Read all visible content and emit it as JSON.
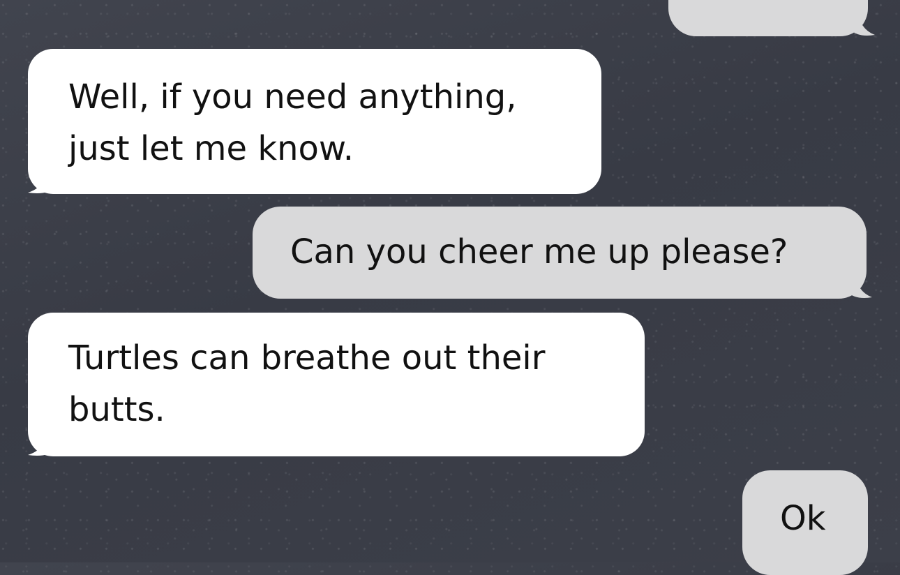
{
  "conversation": {
    "messages": [
      {
        "sender": "other",
        "text": ""
      },
      {
        "sender": "other",
        "text": "Well, if you need anything,\njust let me know."
      },
      {
        "sender": "me",
        "text": "Can you cheer me up please?"
      },
      {
        "sender": "other",
        "text": "Turtles can breathe out their\nbutts."
      },
      {
        "sender": "me",
        "text": "Ok"
      }
    ]
  },
  "colors": {
    "background": "#3a3d47",
    "received_bubble": "#ffffff",
    "sent_bubble": "#d9d9da",
    "text": "#111111"
  }
}
